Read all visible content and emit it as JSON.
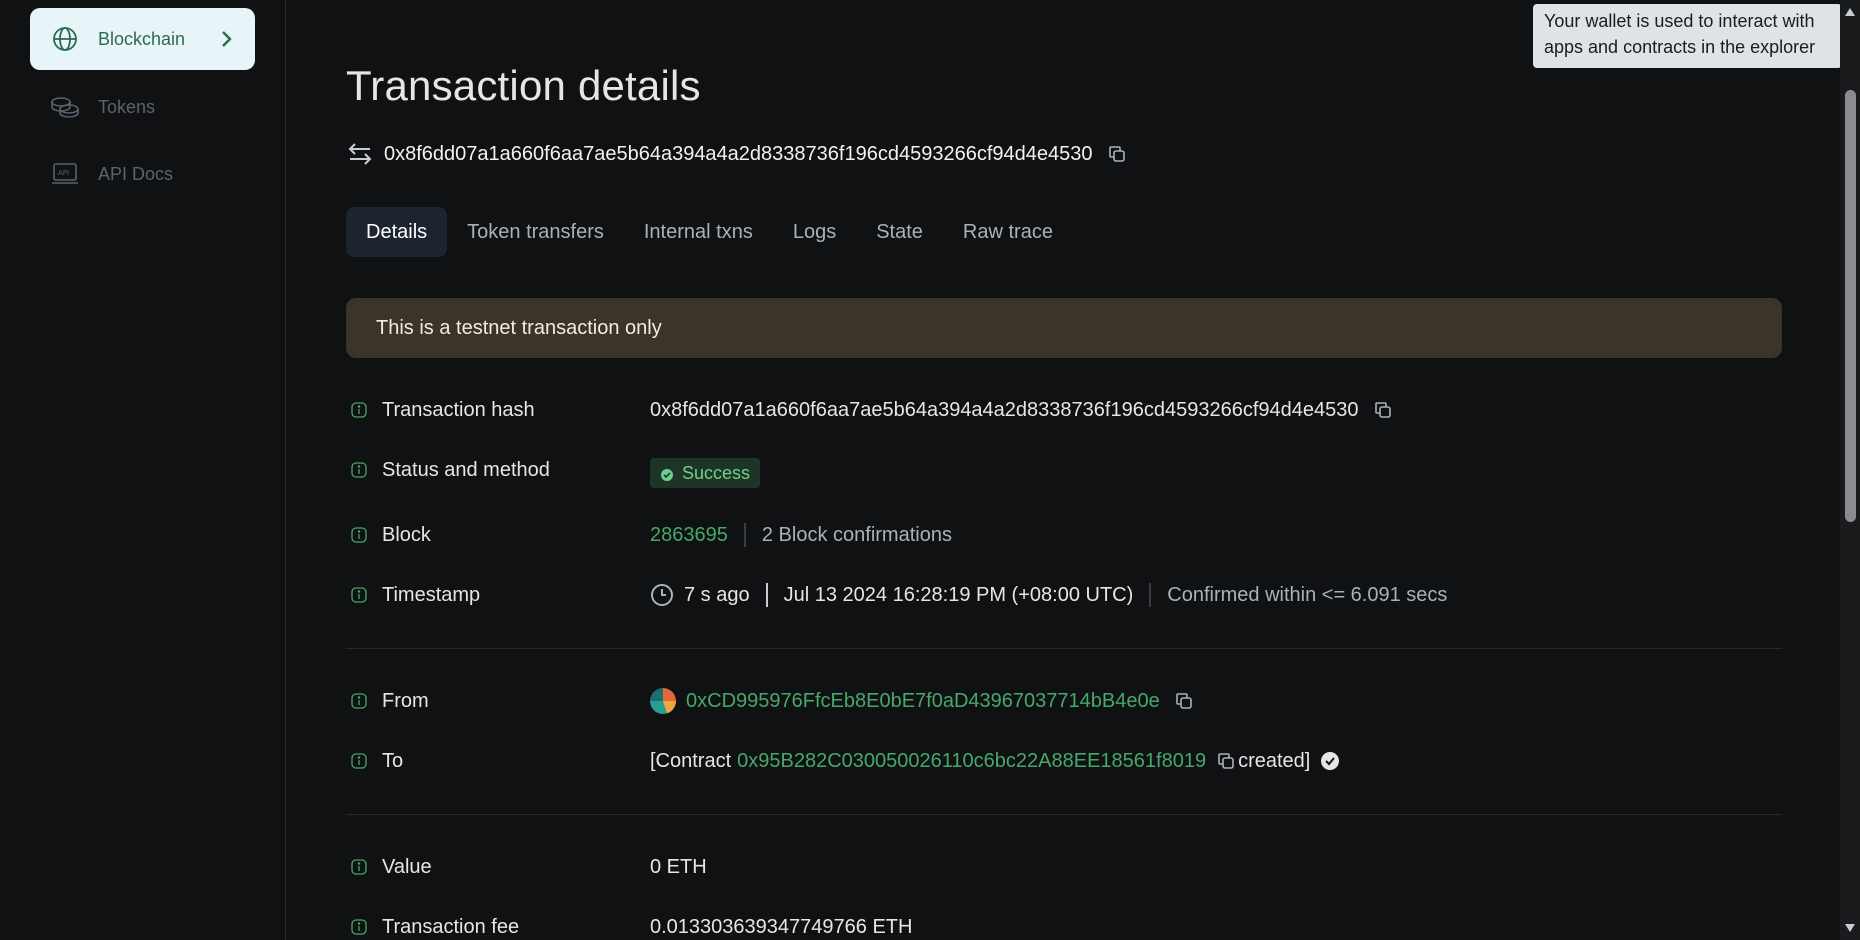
{
  "sidebar": {
    "items": [
      {
        "label": "Blockchain",
        "icon": "globe-icon",
        "active": true
      },
      {
        "label": "Tokens",
        "icon": "coins-icon",
        "active": false
      },
      {
        "label": "API Docs",
        "icon": "api-icon",
        "active": false
      }
    ]
  },
  "page": {
    "title": "Transaction details",
    "hash": "0x8f6dd07a1a660f6aa7ae5b64a394a4a2d8338736f196cd4593266cf94d4e4530"
  },
  "tabs": [
    "Details",
    "Token transfers",
    "Internal txns",
    "Logs",
    "State",
    "Raw trace"
  ],
  "alert": "This is a testnet transaction only",
  "details": {
    "tx_hash": {
      "label": "Transaction hash",
      "value": "0x8f6dd07a1a660f6aa7ae5b64a394a4a2d8338736f196cd4593266cf94d4e4530"
    },
    "status": {
      "label": "Status and method",
      "value": "Success"
    },
    "block": {
      "label": "Block",
      "number": "2863695",
      "confirmations": "2 Block confirmations"
    },
    "timestamp": {
      "label": "Timestamp",
      "ago": "7 s ago",
      "date": "Jul 13 2024 16:28:19 PM (+08:00 UTC)",
      "confirmed": "Confirmed within <= 6.091 secs"
    },
    "from": {
      "label": "From",
      "address": "0xCD995976FfcEb8E0bE7f0aD43967037714bB4e0e"
    },
    "to": {
      "label": "To",
      "prefix": "[Contract",
      "address": "0x95B282C030050026110c6bc22A88EE18561f8019",
      "suffix": "created]"
    },
    "value": {
      "label": "Value",
      "value": "0 ETH"
    },
    "fee": {
      "label": "Transaction fee",
      "value": "0.013303639347749766 ETH"
    }
  },
  "tooltip": {
    "line1": "Your wallet is used to interact with",
    "line2": "apps and contracts in the explorer"
  },
  "colors": {
    "accent_green": "#46a86a",
    "success_bg": "#1e3427",
    "alert_bg": "#3a3528"
  }
}
